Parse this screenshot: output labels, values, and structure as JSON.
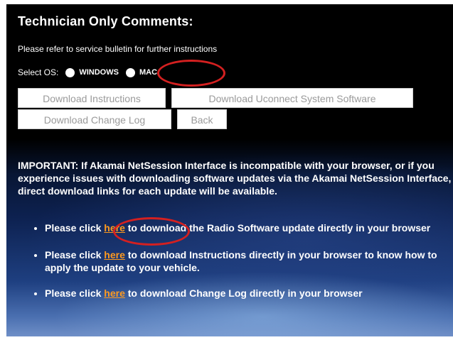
{
  "page": {
    "title": "Technician Only Comments:",
    "refer_text": "Please refer to service bulletin for further instructions",
    "select_os_label": "Select OS:",
    "os_options": [
      "WINDOWS",
      "MAC"
    ],
    "buttons": {
      "download_instructions": "Download Instructions",
      "download_software": "Download Uconnect System Software",
      "download_changelog": "Download Change Log",
      "back": "Back"
    },
    "important_text": "IMPORTANT: If Akamai NetSession Interface is incompatible with your browser, or if you experience issues with downloading software updates via the Akamai NetSession Interface, direct download links for each update will be available.",
    "bullets": [
      {
        "pre": "Please click ",
        "link": "here",
        "post": " to download the Radio Software update directly in your browser"
      },
      {
        "pre": "Please click ",
        "link": "here",
        "post": " to download Instructions directly in your browser to know how to apply the update to your vehicle."
      },
      {
        "pre": "Please click ",
        "link": "here",
        "post": " to download Change Log directly in your browser"
      }
    ]
  },
  "colors": {
    "link": "#ff9a1f",
    "annotation_circle": "#d42020",
    "button_text": "#9a9a9a"
  }
}
